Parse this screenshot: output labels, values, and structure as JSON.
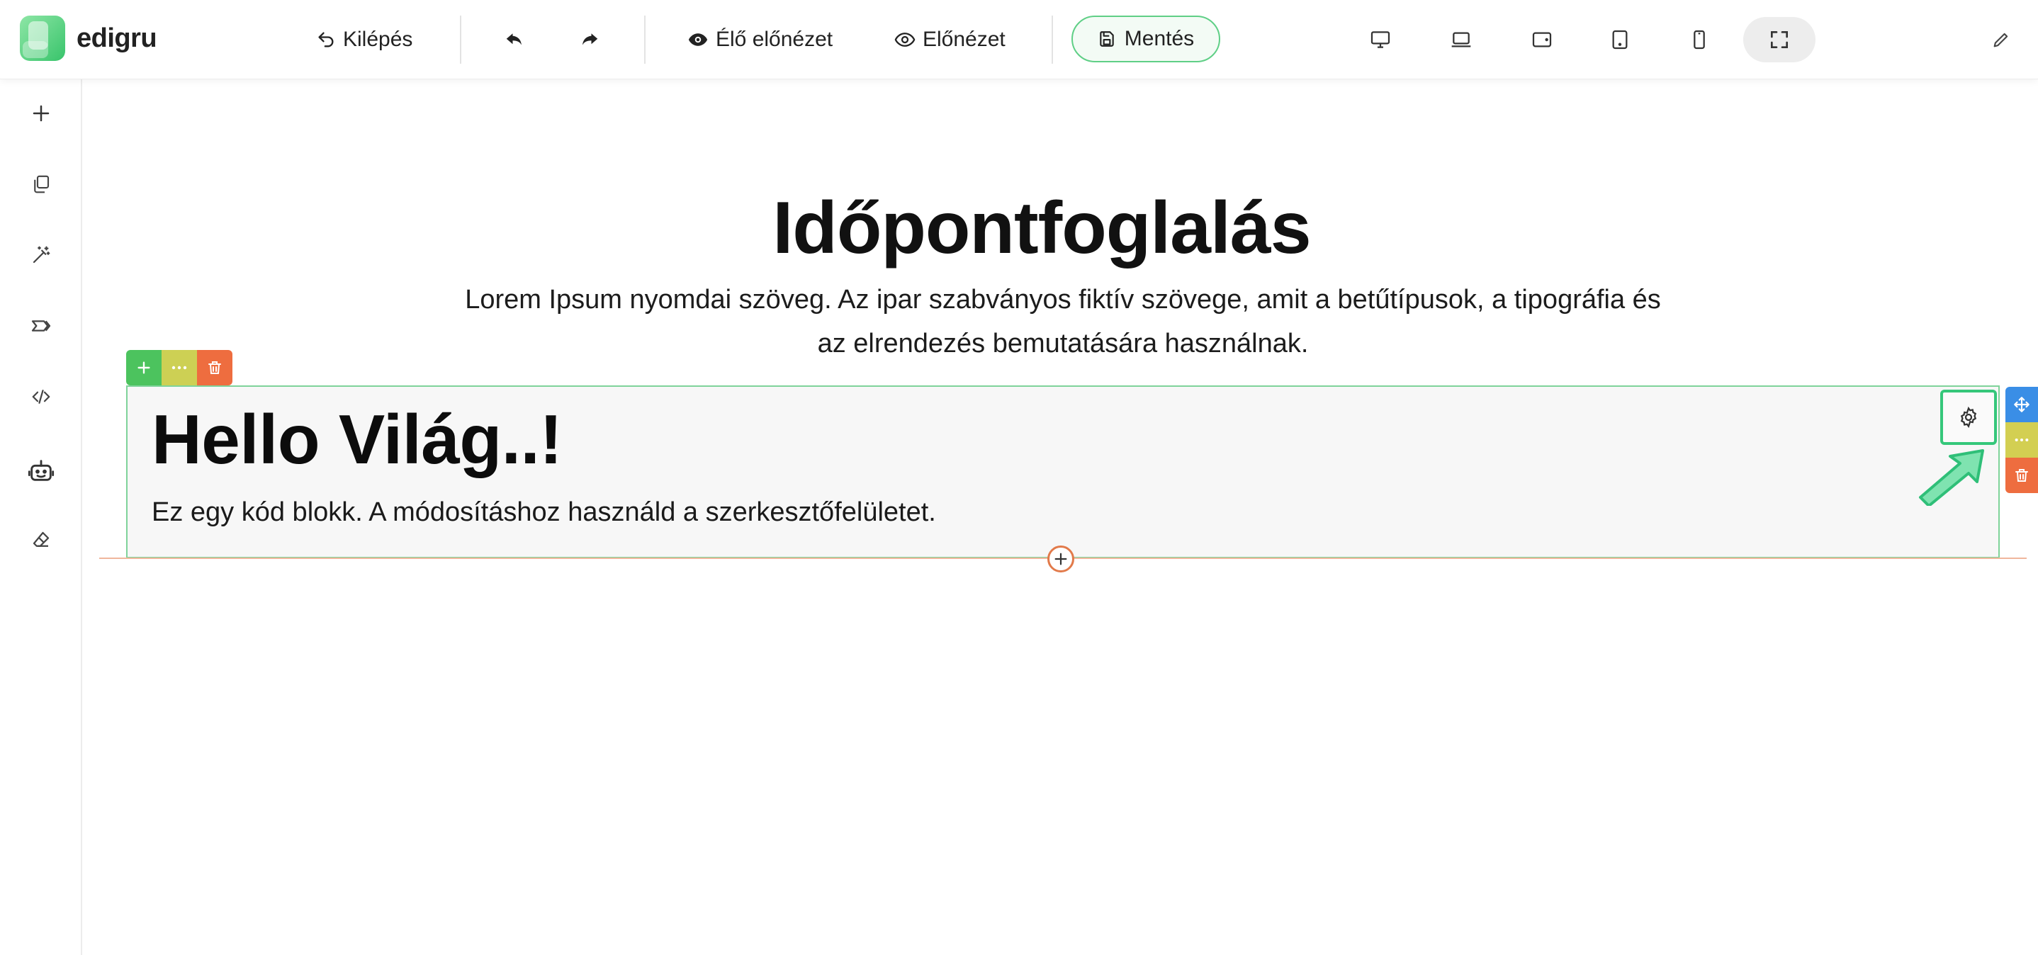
{
  "brand": {
    "name": "edigru"
  },
  "toolbar": {
    "exit_label": "Kilépés",
    "live_preview_label": "Élő előnézet",
    "preview_label": "Előnézet",
    "save_label": "Mentés",
    "devices": [
      "desktop",
      "laptop",
      "tablet-landscape",
      "tablet-portrait",
      "mobile",
      "fullscreen"
    ],
    "active_device": "fullscreen"
  },
  "sidebar": {
    "items": [
      "add",
      "pages",
      "magic",
      "layers",
      "code",
      "ai-assistant",
      "eraser"
    ]
  },
  "page": {
    "title": "Időpontfoglalás",
    "subtitle": "Lorem Ipsum nyomdai szöveg. Az ipar szabványos fiktív szövege, amit a betűtípusok, a tipográfia és az elrendezés bemutatására használnak."
  },
  "code_block": {
    "heading": "Hello Világ..!",
    "text": "Ez egy kód blokk. A módosításhoz használd a szerkesztőfelületet."
  },
  "colors": {
    "accent_green": "#4cc35e",
    "accent_yellow": "#cdd054",
    "accent_orange": "#ee6d3f",
    "accent_blue": "#3a8ee6",
    "highlight_green": "#35c77a"
  }
}
